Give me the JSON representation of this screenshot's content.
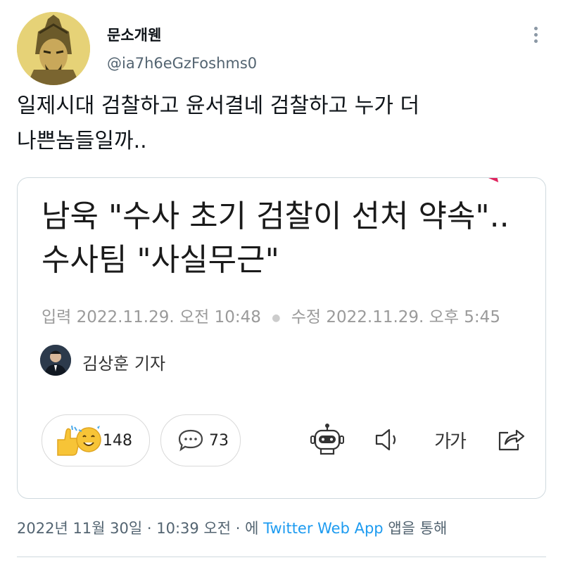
{
  "author": {
    "display_name": "문소개웬",
    "handle": "@ia7h6eGzFoshms0",
    "avatar_icon": "helmeted-warrior-avatar",
    "more_icon": "more-options-icon"
  },
  "tweet": {
    "text": "일제시대 검찰하고 윤서결네 검찰하고 누가 더\n나쁜놈들일까..",
    "timestamp": "2022년 11월 30일 · 10:39 오전 · 에",
    "via_app": "Twitter Web App",
    "via_suffix": "앱을 통해"
  },
  "article": {
    "headline": "남욱 \"수사 초기 검찰이 선처 약속\"..수사팀 \"사실무근\"",
    "published_label": "입력",
    "published": "2022.11.29. 오전 10:48",
    "modified_label": "수정",
    "modified": "2022.11.29. 오후 5:45",
    "reporter": "김상훈 기자",
    "reaction_count": "148",
    "comment_count": "73",
    "font_size_label": "가가",
    "icons": [
      "robot-summary-icon",
      "speaker-icon",
      "font-size-icon",
      "share-icon"
    ]
  },
  "colors": {
    "link": "#1d9bf0",
    "secondary_text": "#536471",
    "card_border": "#cfd9de",
    "corner_accent": "#e0245e",
    "reaction_yellow": "#f7c437"
  }
}
